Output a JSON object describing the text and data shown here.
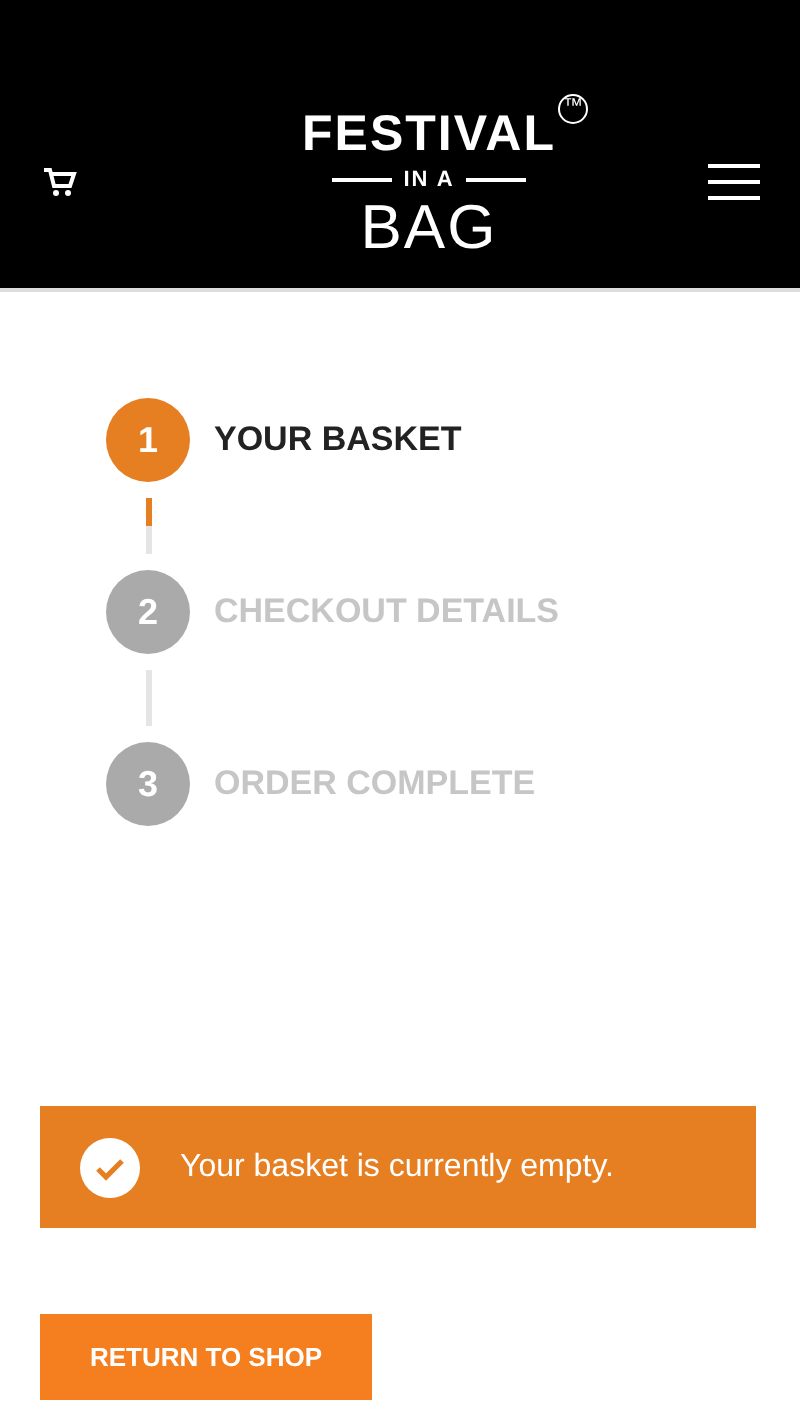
{
  "header": {
    "logo": {
      "line1": "FESTIVAL",
      "trademark": "™",
      "line2": "IN A",
      "line3": "BAG"
    }
  },
  "steps": [
    {
      "number": "1",
      "label": "YOUR BASKET",
      "selected": true
    },
    {
      "number": "2",
      "label": "CHECKOUT DETAILS",
      "selected": false
    },
    {
      "number": "3",
      "label": "ORDER COMPLETE",
      "selected": false
    }
  ],
  "notice": {
    "message": "Your basket is currently empty."
  },
  "button": {
    "label": "RETURN TO SHOP"
  }
}
